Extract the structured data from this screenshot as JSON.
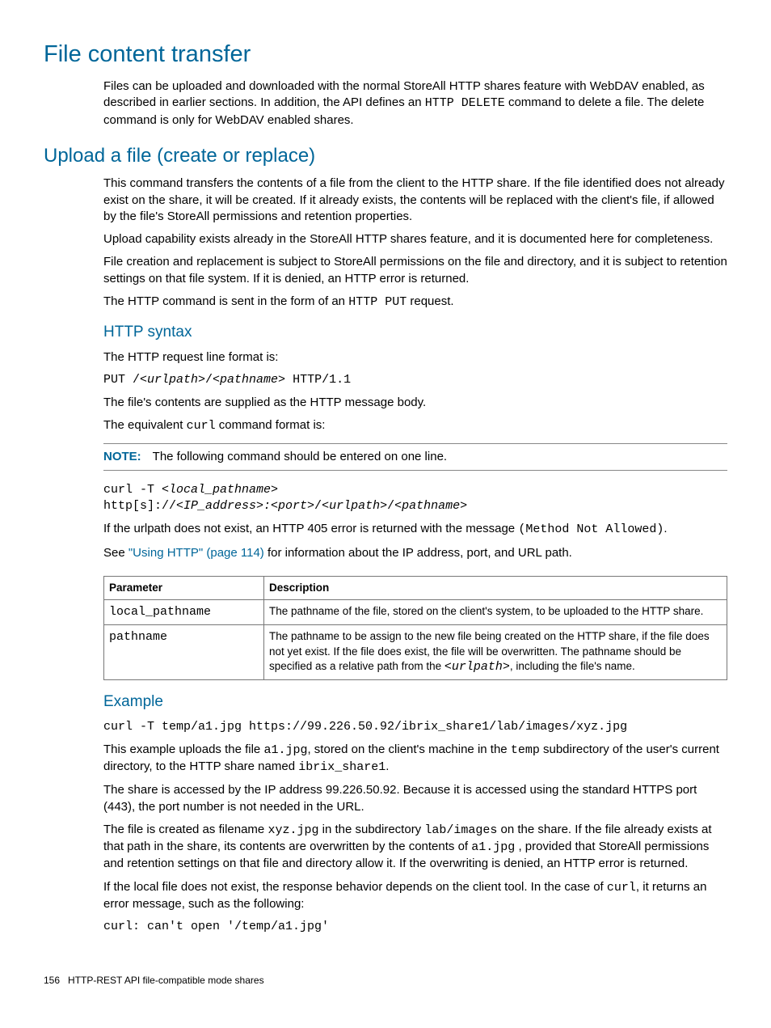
{
  "h1": "File content transfer",
  "intro_before": "Files can be uploaded and downloaded with the normal StoreAll HTTP shares feature with WebDAV enabled, as described in earlier sections. In addition, the API defines an ",
  "intro_code": "HTTP DELETE",
  "intro_after": " command to delete a file. The delete command is only for WebDAV enabled shares.",
  "h2_upload": "Upload a file (create or replace)",
  "upload_p1": "This command transfers the contents of a file from the client to the HTTP share. If the file identified does not already exist on the share, it will be created. If it already exists, the contents will be replaced with the client's file, if allowed by the file's StoreAll permissions and retention properties.",
  "upload_p2": "Upload capability exists already in the StoreAll HTTP shares feature, and it is documented here for completeness.",
  "upload_p3": "File creation and replacement is subject to StoreAll permissions on the file and directory, and it is subject to retention settings on that file system. If it is denied, an HTTP error is returned.",
  "upload_p4_before": "The HTTP command is sent in the form of an ",
  "upload_p4_code": "HTTP PUT",
  "upload_p4_after": " request.",
  "h3_syntax": "HTTP syntax",
  "syntax_p1": "The HTTP request line format is:",
  "put_a": "PUT /",
  "put_b": "<urlpath>",
  "put_c": "/",
  "put_d": "<pathname>",
  "put_e": " HTTP/1.1",
  "syntax_p2": "The file's contents are supplied as the HTTP message body.",
  "syntax_p3_before": "The equivalent ",
  "syntax_p3_code": "curl",
  "syntax_p3_after": " command format is:",
  "note_label": "NOTE:",
  "note_text": "The following command should be entered on one line.",
  "curl_a": "curl -T ",
  "curl_b": "<local_pathname>",
  "curl_c": "\nhttp[s]://",
  "curl_d": "<IP_address>:<port>",
  "curl_e": "/",
  "curl_f": "<urlpath>",
  "curl_g": "/",
  "curl_h": "<pathname>",
  "err_before": "If the urlpath does not exist, an HTTP 405 error is returned with the message ",
  "err_code": "(Method Not Allowed)",
  "err_after": ".",
  "see_before": "See ",
  "see_link": "\"Using HTTP\" (page 114)",
  "see_after": " for information about the IP address, port, and URL path.",
  "table": {
    "h1": "Parameter",
    "h2": "Description",
    "r1c1": "local_pathname",
    "r1c2": "The pathname of the file, stored on the client's system, to be uploaded to the HTTP share.",
    "r2c1": "pathname",
    "r2c2_before": "The pathname to be assign to the new file being created on the HTTP share, if the file does not yet exist. If the file does exist, the file will be overwritten. The pathname should be specified as a relative path from the ",
    "r2c2_code": "<urlpath>",
    "r2c2_after": ", including the file's name."
  },
  "h3_example": "Example",
  "example_cmd": "curl -T temp/a1.jpg https://99.226.50.92/ibrix_share1/lab/images/xyz.jpg",
  "ex_p1_a": "This example uploads the file ",
  "ex_p1_b": "a1.jpg",
  "ex_p1_c": ", stored on the client's machine in the ",
  "ex_p1_d": "temp",
  "ex_p1_e": " subdirectory of the user's current directory, to the HTTP share named ",
  "ex_p1_f": "ibrix_share1",
  "ex_p1_g": ".",
  "ex_p2": "The share is accessed by the IP address 99.226.50.92. Because it is accessed using the standard HTTPS port (443), the port number is not needed in the URL.",
  "ex_p3_a": "The file is created as filename ",
  "ex_p3_b": "xyz.jpg",
  "ex_p3_c": " in the subdirectory ",
  "ex_p3_d": "lab/images",
  "ex_p3_e": " on the share. If the file already exists at that path in the share, its contents are overwritten by the contents of ",
  "ex_p3_f": "a1.jpg",
  "ex_p3_g": " , provided that StoreAll permissions and retention settings on that file and directory allow it. If the overwriting is denied, an HTTP error is returned.",
  "ex_p4_a": "If the local file does not exist, the response behavior depends on the client tool. In the case of ",
  "ex_p4_b": "curl",
  "ex_p4_c": ", it returns an error message, such as the following:",
  "ex_err": "curl: can't open '/temp/a1.jpg'",
  "footer_page": "156",
  "footer_text": "HTTP-REST API file-compatible mode shares"
}
